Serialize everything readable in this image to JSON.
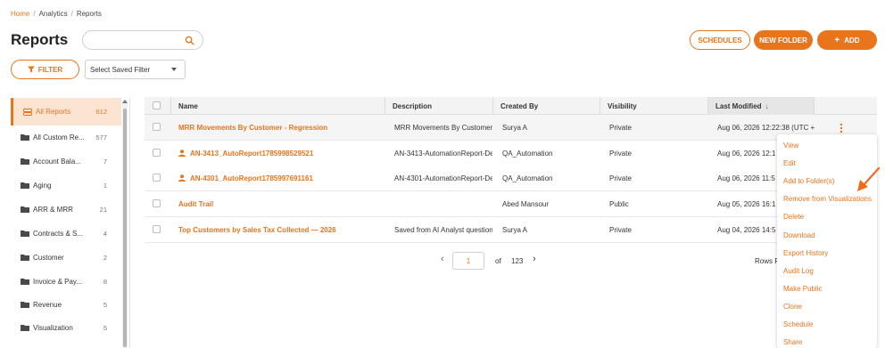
{
  "breadcrumb": {
    "home": "Home",
    "analytics": "Analytics",
    "reports": "Reports"
  },
  "page": {
    "title": "Reports"
  },
  "search": {
    "value": "",
    "placeholder": ""
  },
  "toolbar": {
    "schedules": "SCHEDULES",
    "new_folder": "NEW FOLDER",
    "add": "ADD",
    "add_icon": "+",
    "filter": "FILTER",
    "saved_filter": "Select Saved Filter"
  },
  "sidebar": {
    "items": [
      {
        "label": "All Reports",
        "count": "612",
        "icon": "stack-icon"
      },
      {
        "label": "All Custom Re...",
        "count": "577",
        "icon": "folder-icon"
      },
      {
        "label": "Account Bala...",
        "count": "7",
        "icon": "folder-icon"
      },
      {
        "label": "Aging",
        "count": "1",
        "icon": "folder-icon"
      },
      {
        "label": "ARR & MRR",
        "count": "21",
        "icon": "folder-icon"
      },
      {
        "label": "Contracts & S...",
        "count": "4",
        "icon": "folder-icon"
      },
      {
        "label": "Customer",
        "count": "2",
        "icon": "folder-icon"
      },
      {
        "label": "Invoice & Pay...",
        "count": "8",
        "icon": "folder-icon"
      },
      {
        "label": "Revenue",
        "count": "5",
        "icon": "folder-icon"
      },
      {
        "label": "Visualization",
        "count": "5",
        "icon": "folder-icon"
      }
    ]
  },
  "table": {
    "headers": {
      "name": "Name",
      "description": "Description",
      "created_by": "Created By",
      "visibility": "Visibility",
      "last_modified": "Last Modified",
      "sort_icon": "↓"
    },
    "rows": [
      {
        "name": "MRR Movements By Customer - Regression",
        "description": "MRR Movements By Customer",
        "created_by": "Surya A",
        "visibility": "Private",
        "last_modified": "Aug 06, 2026 12:22:38 (UTC +",
        "user_icon": false
      },
      {
        "name": "AN-3413_AutoReport1785998529521",
        "description": "AN-3413-AutomationReport-De",
        "created_by": "QA_Automation",
        "visibility": "Private",
        "last_modified": "Aug 06, 2026 12:1",
        "user_icon": true
      },
      {
        "name": "AN-4301_AutoReport1785997691161",
        "description": "AN-4301-AutomationReport-De",
        "created_by": "QA_Automation",
        "visibility": "Private",
        "last_modified": "Aug 06, 2026 11:5",
        "user_icon": true
      },
      {
        "name": "Audit Trail",
        "description": "",
        "created_by": "Abed Mansour",
        "visibility": "Public",
        "last_modified": "Aug 05, 2026 16:1",
        "user_icon": false
      },
      {
        "name": "Top Customers by Sales Tax Collected — 2026",
        "description": "Saved from AI Analyst question",
        "created_by": "Surya A",
        "visibility": "Private",
        "last_modified": "Aug 04, 2026 14:5",
        "user_icon": false
      }
    ]
  },
  "pagination": {
    "prev": "‹",
    "page": "1",
    "of": "of",
    "total": "123",
    "next": "›",
    "rows_label": "Rows P"
  },
  "context_menu": {
    "items": [
      "View",
      "Edit",
      "Add to Folder(s)",
      "Remove from Visualizations",
      "Delete",
      "Download",
      "Export History",
      "Audit Log",
      "Make Public",
      "Clone",
      "Schedule",
      "Share"
    ]
  },
  "colors": {
    "accent": "#e8741c",
    "active_bg": "#fbe4d2"
  }
}
